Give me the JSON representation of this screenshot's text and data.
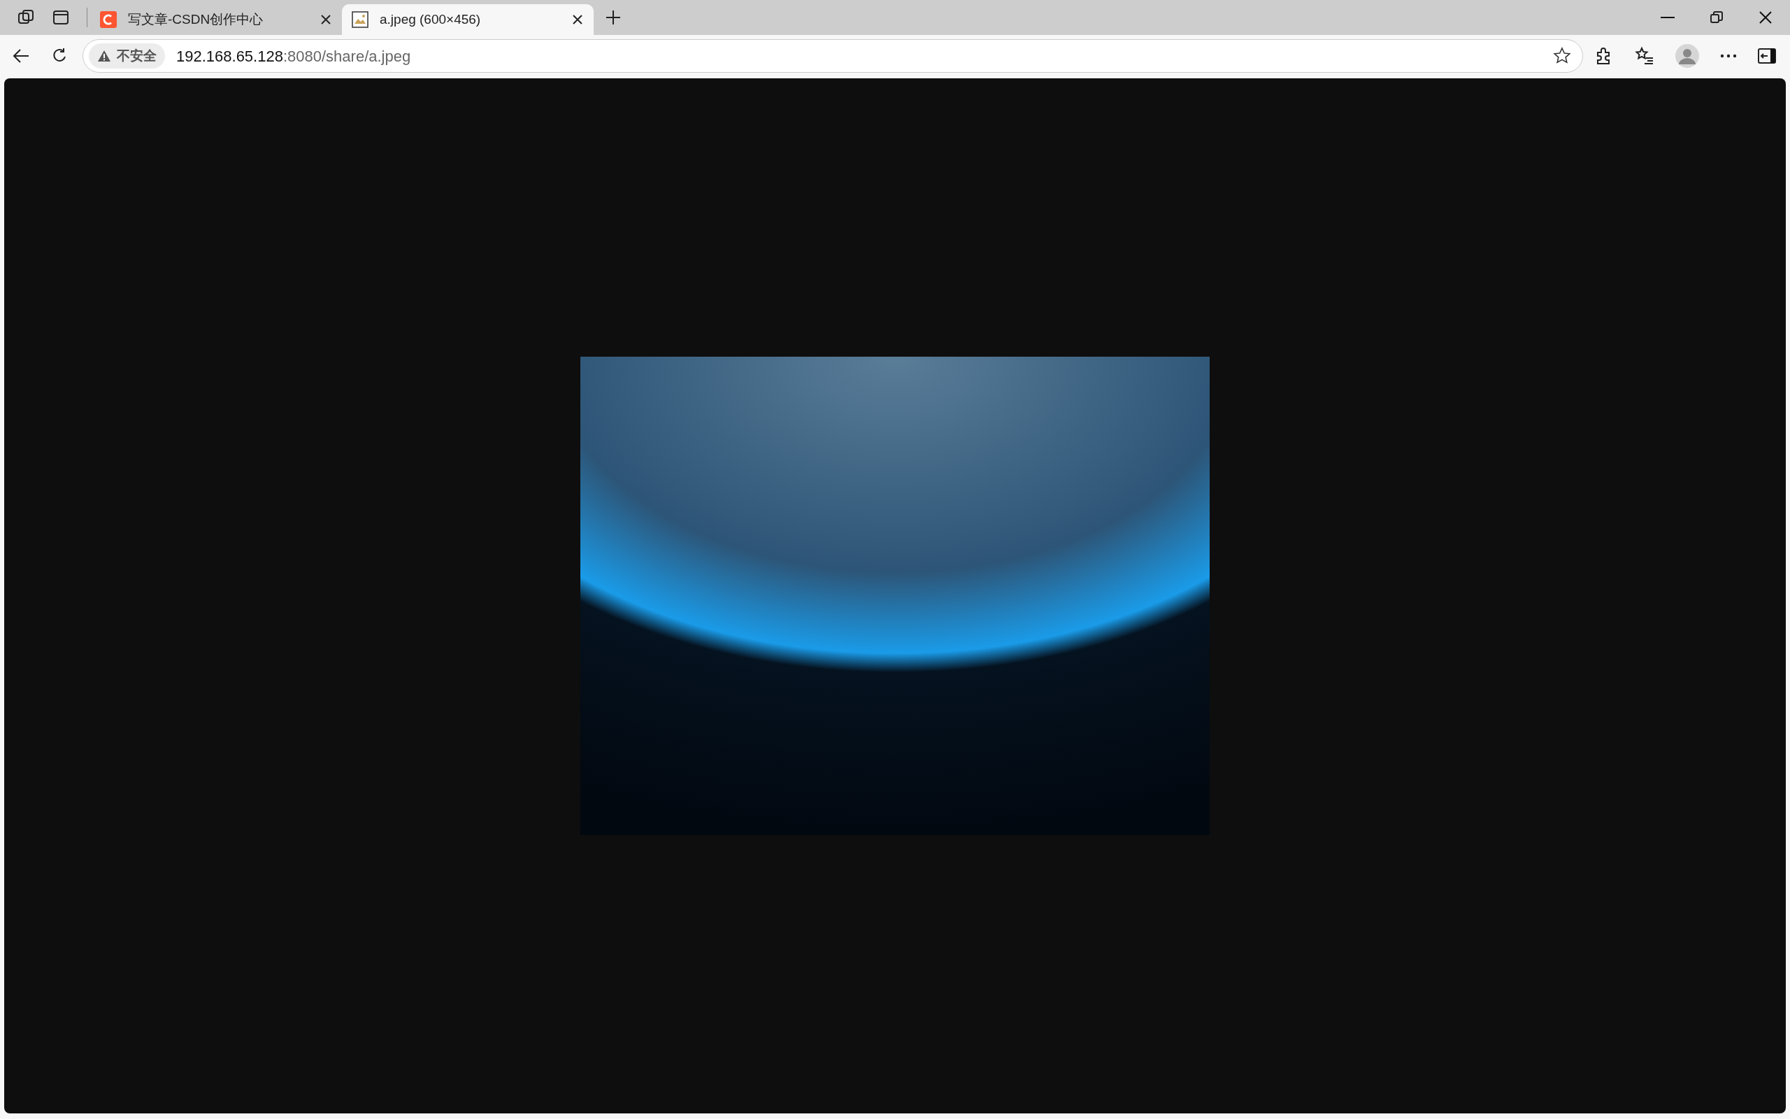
{
  "tabs": [
    {
      "title": "写文章-CSDN创作中心",
      "kind": "csdn",
      "selected": false
    },
    {
      "title": "a.jpeg (600×456)",
      "kind": "image",
      "selected": true
    }
  ],
  "address_bar": {
    "security_label": "不安全",
    "url_host": "192.168.65.128",
    "url_rest": ":8080/share/a.jpeg"
  },
  "content": {
    "kind": "image"
  }
}
